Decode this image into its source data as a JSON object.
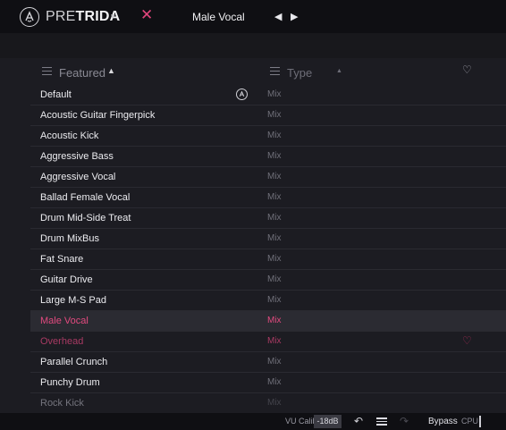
{
  "header": {
    "brand_light": "PRE",
    "brand_bold": "TRIDA",
    "dropdown_caret": "▾",
    "close_glyph": "✕",
    "preset_name": "Male Vocal",
    "prev_glyph": "◀",
    "next_glyph": "▶"
  },
  "browser": {
    "featured_label": "Featured",
    "featured_sort_glyph": "▲",
    "type_label": "Type",
    "type_sort_glyph": "▲",
    "favorites_glyph": "♡",
    "presets": [
      {
        "name": "Default",
        "type": "Mix",
        "state": "normal"
      },
      {
        "name": "Acoustic Guitar Fingerpick",
        "type": "Mix",
        "state": "normal"
      },
      {
        "name": "Acoustic Kick",
        "type": "Mix",
        "state": "normal"
      },
      {
        "name": "Aggressive Bass",
        "type": "Mix",
        "state": "normal"
      },
      {
        "name": "Aggressive Vocal",
        "type": "Mix",
        "state": "normal"
      },
      {
        "name": "Ballad Female Vocal",
        "type": "Mix",
        "state": "normal"
      },
      {
        "name": "Drum Mid-Side Treat",
        "type": "Mix",
        "state": "normal"
      },
      {
        "name": "Drum MixBus",
        "type": "Mix",
        "state": "normal"
      },
      {
        "name": "Fat Snare",
        "type": "Mix",
        "state": "normal"
      },
      {
        "name": "Guitar Drive",
        "type": "Mix",
        "state": "normal"
      },
      {
        "name": "Large M-S Pad",
        "type": "Mix",
        "state": "normal"
      },
      {
        "name": "Male Vocal",
        "type": "Mix",
        "state": "selected"
      },
      {
        "name": "Overhead",
        "type": "Mix",
        "state": "hover-favorite"
      },
      {
        "name": "Parallel Crunch",
        "type": "Mix",
        "state": "normal"
      },
      {
        "name": "Punchy Drum",
        "type": "Mix",
        "state": "normal"
      },
      {
        "name": "Rock Kick",
        "type": "Mix",
        "state": "faded"
      }
    ]
  },
  "footer": {
    "vu_calib_label": "VU Calib",
    "vu_calib_value": "-18dB",
    "undo_glyph": "↶",
    "redo_glyph": "↷",
    "bypass_label": "Bypass",
    "cpu_label": "CPU"
  },
  "colors": {
    "accent": "#e24a7f",
    "background": "#1c1c22",
    "topbar": "#0f0f13",
    "selected_row": "#2b2b32"
  }
}
